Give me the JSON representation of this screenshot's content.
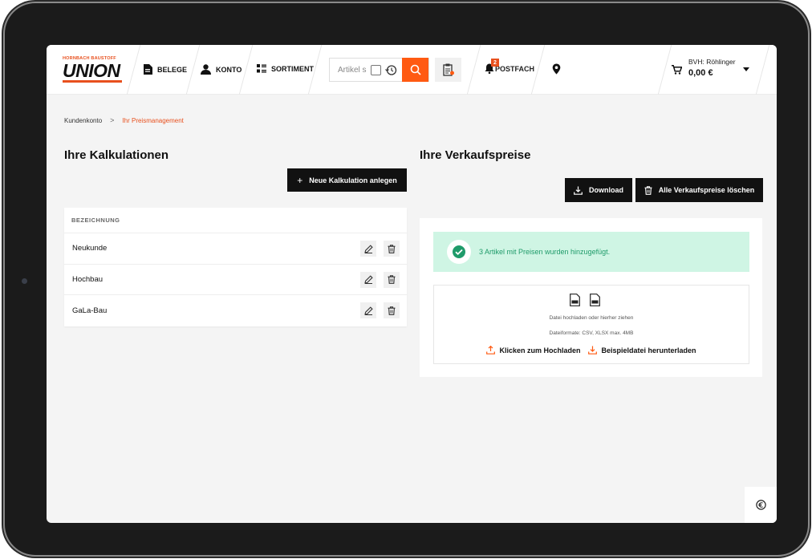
{
  "header": {
    "logo_top": "HORNBACH BAUSTOFF",
    "logo_brand": "UNION",
    "nav": {
      "belege": "BELEGE",
      "konto": "KONTO",
      "sortiment": "SORTIMENT"
    },
    "search_placeholder": "Artikel s",
    "postfach_label": "POSTFACH",
    "postfach_badge": "2",
    "account_name": "BVH: Röhlinger",
    "account_amount": "0,00 €"
  },
  "breadcrumb": {
    "home": "Kundenkonto",
    "separator": ">",
    "current": "Ihr Preismanagement"
  },
  "kalkulationen": {
    "title": "Ihre Kalkulationen",
    "new_button": "Neue Kalkulation anlegen",
    "column_header": "BEZEICHNUNG",
    "rows": [
      {
        "name": "Neukunde"
      },
      {
        "name": "Hochbau"
      },
      {
        "name": "GaLa-Bau"
      }
    ]
  },
  "verkaufspreise": {
    "title": "Ihre Verkaufspreise",
    "download_button": "Download",
    "delete_all_button": "Alle Verkaufspreise löschen",
    "success_message": "3 Artikel mit Preisen wurden hinzugefügt.",
    "upload_hint": "Datei hochladen oder hierher ziehen",
    "formats_hint": "Dateiformate: CSV, XLSX max. 4MB",
    "upload_link": "Klicken zum Hochladen",
    "sample_link": "Beispieldatei herunterladen"
  },
  "colors": {
    "accent": "#ff5a12",
    "dark": "#111111",
    "success_bg": "#cff5e4",
    "success_text": "#1f9b6a"
  }
}
